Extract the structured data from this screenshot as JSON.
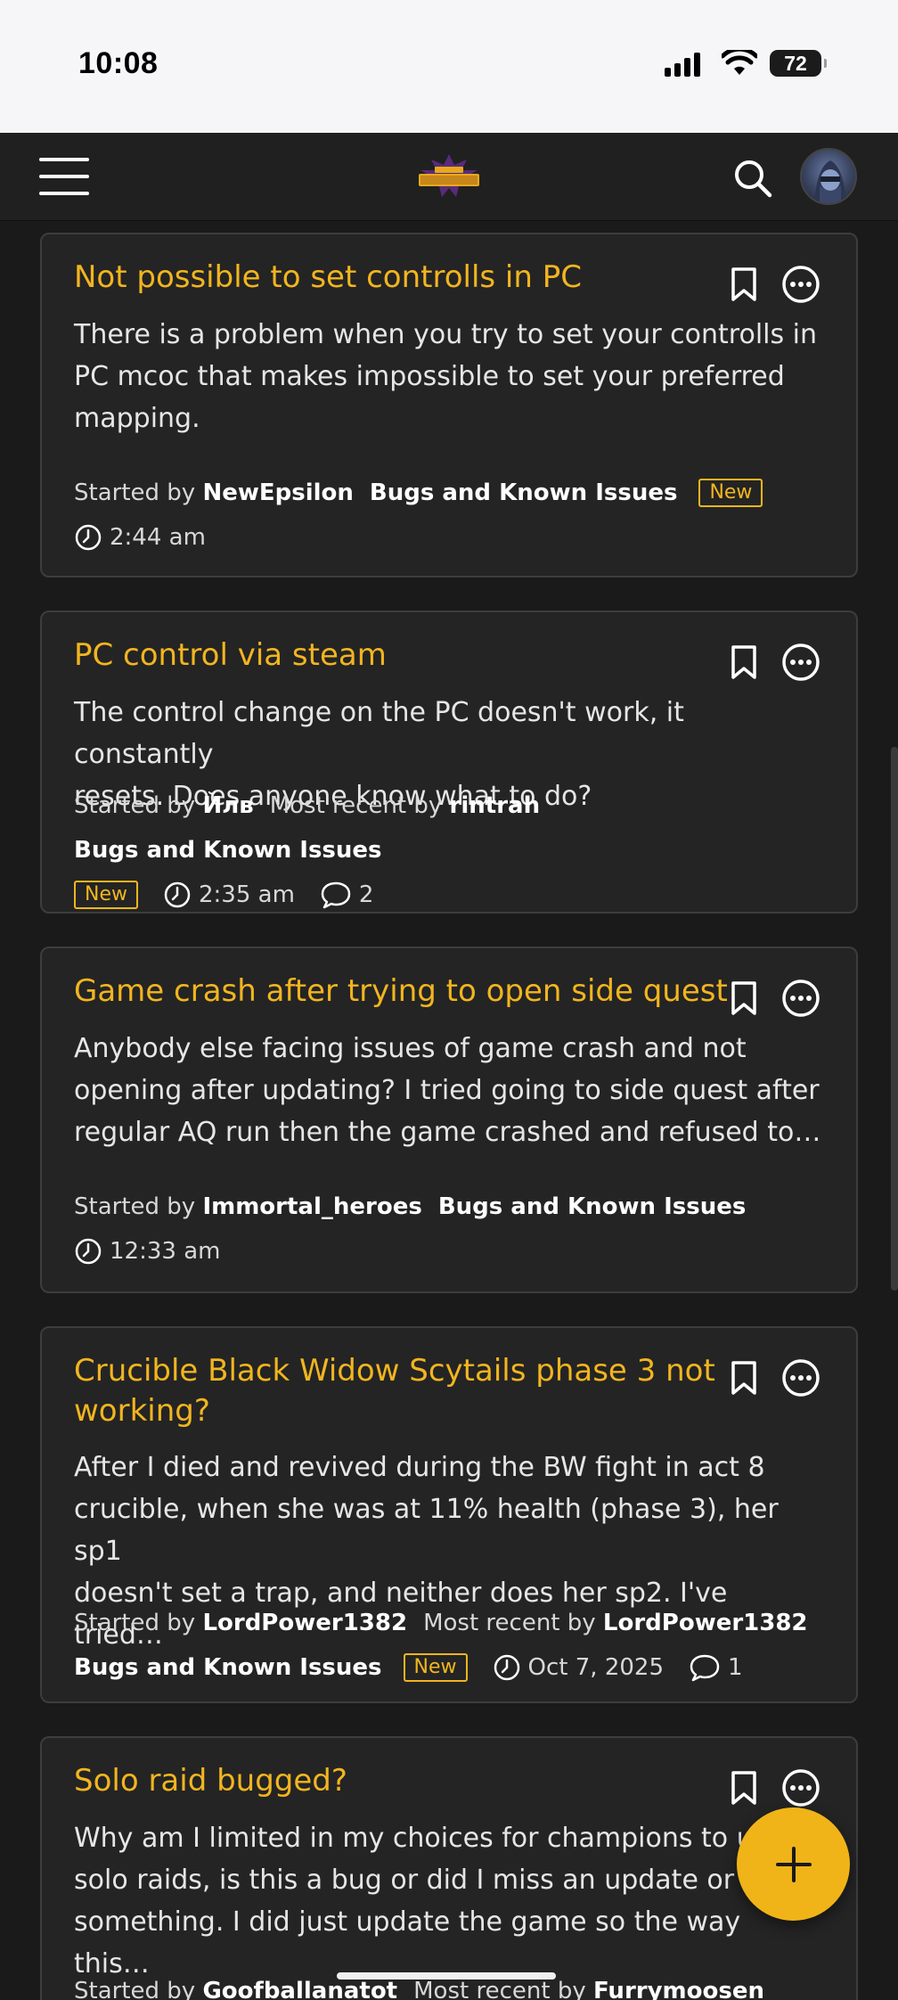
{
  "status_bar": {
    "time": "10:08",
    "battery": "72"
  },
  "header": {
    "logo_alt": "Marvel Contest of Champions"
  },
  "colors": {
    "accent": "#f2b51f",
    "card_bg": "#242424",
    "page_bg": "#1a1a1a"
  },
  "labels": {
    "started_by": "Started by",
    "most_recent_by": "Most recent by"
  },
  "discussions": [
    {
      "title": "Not possible to set controlls in PC",
      "excerpt_lines": [
        "There is a problem when you try to set your controlls in",
        "PC mcoc that makes impossible to set your preferred",
        "mapping."
      ],
      "author": "NewEpsilon",
      "category": "Bugs and Known Issues",
      "badge": "New",
      "time": "2:44 am"
    },
    {
      "title": "PC control via steam",
      "excerpt_lines": [
        "The control change on the PC doesn't work, it constantly",
        "resets. Does anyone know what to do?"
      ],
      "author": "Йлв",
      "most_recent": "rintrah",
      "category": "Bugs and Known Issues",
      "badge": "New",
      "time": "2:35 am",
      "comments": "2"
    },
    {
      "title": "Game crash after trying to open side quest",
      "excerpt_lines": [
        "Anybody else facing issues of game crash and not",
        "opening after updating? I tried going to side quest after",
        "regular AQ run then the game crashed and refused to…"
      ],
      "author": "Immortal_heroes",
      "category": "Bugs and Known Issues",
      "time": "12:33 am"
    },
    {
      "title_lines": [
        "Crucible Black Widow Scytails phase 3 not",
        "working?"
      ],
      "excerpt_lines": [
        "After I died and revived during the BW fight in act 8",
        "crucible, when she was at 11% health (phase 3), her sp1",
        "doesn't set a trap, and neither does her sp2. I've tried…"
      ],
      "author": "LordPower1382",
      "most_recent": "LordPower1382",
      "category": "Bugs and Known Issues",
      "badge": "New",
      "time": "Oct 7, 2025",
      "comments": "1"
    },
    {
      "title": "Solo raid bugged?",
      "excerpt_lines": [
        "Why am I limited in my choices for champions to use in",
        "solo raids, is this a bug or did I miss an update or",
        "something. I did just update the game so the way this…"
      ],
      "author": "Goofballanatot",
      "most_recent": "Furrymoosen"
    }
  ]
}
